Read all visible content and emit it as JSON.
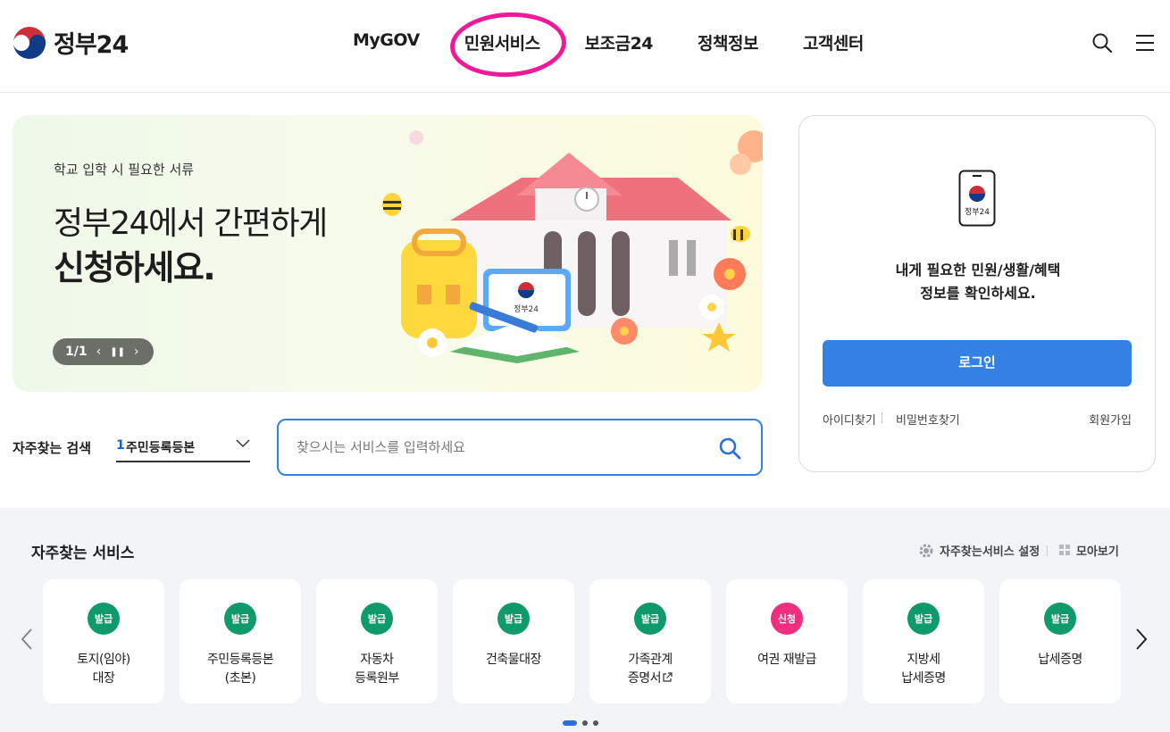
{
  "header": {
    "logo_text": "정부24",
    "nav": [
      "MyGOV",
      "민원서비스",
      "보조금24",
      "정책정보",
      "고객센터"
    ]
  },
  "banner": {
    "subtitle": "학교 입학 시 필요한 서류",
    "title_line1": "정부24에서 간편하게",
    "title_line2": "신청하세요.",
    "pager": "1/1",
    "art_label": "정부24"
  },
  "login": {
    "phone_label": "정부24",
    "message_line1": "내게 필요한 민원/생활/혜택",
    "message_line2": "정보를 확인하세요.",
    "button": "로그인",
    "find_id": "아이디찾기",
    "find_pw": "비밀번호찾기",
    "signup": "회원가입"
  },
  "search": {
    "label": "자주찾는 검색",
    "selected_rank": "1",
    "selected_text": "주민등록등본",
    "placeholder": "찾으시는 서비스를 입력하세요"
  },
  "services": {
    "title": "자주찾는 서비스",
    "setting_label": "자주찾는서비스 설정",
    "viewall_label": "모아보기",
    "items": [
      {
        "badge": "발급",
        "line1": "토지(임야)",
        "line2": "대장"
      },
      {
        "badge": "발급",
        "line1": "주민등록등본",
        "line2": "(초본)"
      },
      {
        "badge": "발급",
        "line1": "자동차",
        "line2": "등록원부"
      },
      {
        "badge": "발급",
        "line1": "건축물대장",
        "line2": ""
      },
      {
        "badge": "발급",
        "line1": "가족관계",
        "line2": "증명서"
      },
      {
        "badge": "신청",
        "line1": "여권 재발급",
        "line2": ""
      },
      {
        "badge": "발급",
        "line1": "지방세",
        "line2": "납세증명"
      },
      {
        "badge": "발급",
        "line1": "납세증명",
        "line2": ""
      }
    ]
  },
  "colors": {
    "primary": "#3481e6",
    "badge_issue": "#0f9a6b",
    "badge_apply": "#ee2e7e",
    "highlight": "#f0199a"
  }
}
